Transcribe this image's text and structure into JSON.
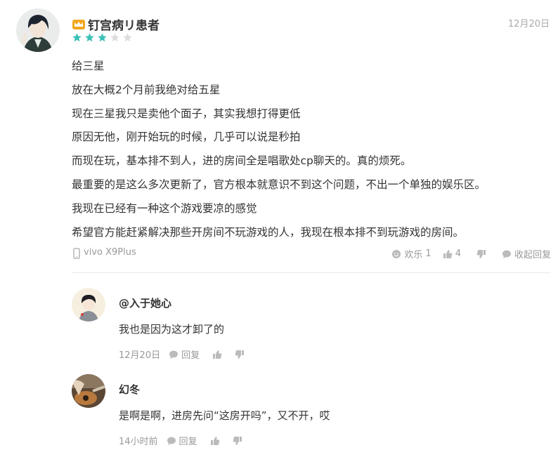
{
  "review": {
    "username": "钉宫病リ患者",
    "date": "12月20日",
    "rating": 3,
    "max_rating": 5,
    "lines": [
      "给三星",
      "放在大概2个月前我绝对给五星",
      "现在三星我只是卖他个面子，其实我想打得更低",
      "原因无他，刚开始玩的时候，几乎可以说是秒拍",
      "而现在玩，基本排不到人，进的房间全是唱歌处cp聊天的。真的烦死。",
      "最重要的是这么多次更新了，官方根本就意识不到这个问题，不出一个单独的娱乐区。",
      "我现在已经有一种这个游戏要凉的感觉",
      "希望官方能赶紧解决那些开房间不玩游戏的人，我现在根本排不到玩游戏的房间。"
    ],
    "device": "vivo X9Plus",
    "like_label": "欢乐",
    "like_count": "1",
    "thumb_count": "4",
    "collapse_label": "收起回复"
  },
  "replies": [
    {
      "username": "@入于她心",
      "text": "我也是因为这才卸了的",
      "time": "12月20日",
      "reply_label": "回复"
    },
    {
      "username": "幻冬",
      "text": "是啊是啊，进房先问“这房开吗”，又不开，哎",
      "time": "14小时前",
      "reply_label": "回复"
    }
  ],
  "colors": {
    "star_filled": "#3cc0b8",
    "star_empty": "#dddddd",
    "crown": "#f0a81e",
    "meta_text": "#999999"
  }
}
